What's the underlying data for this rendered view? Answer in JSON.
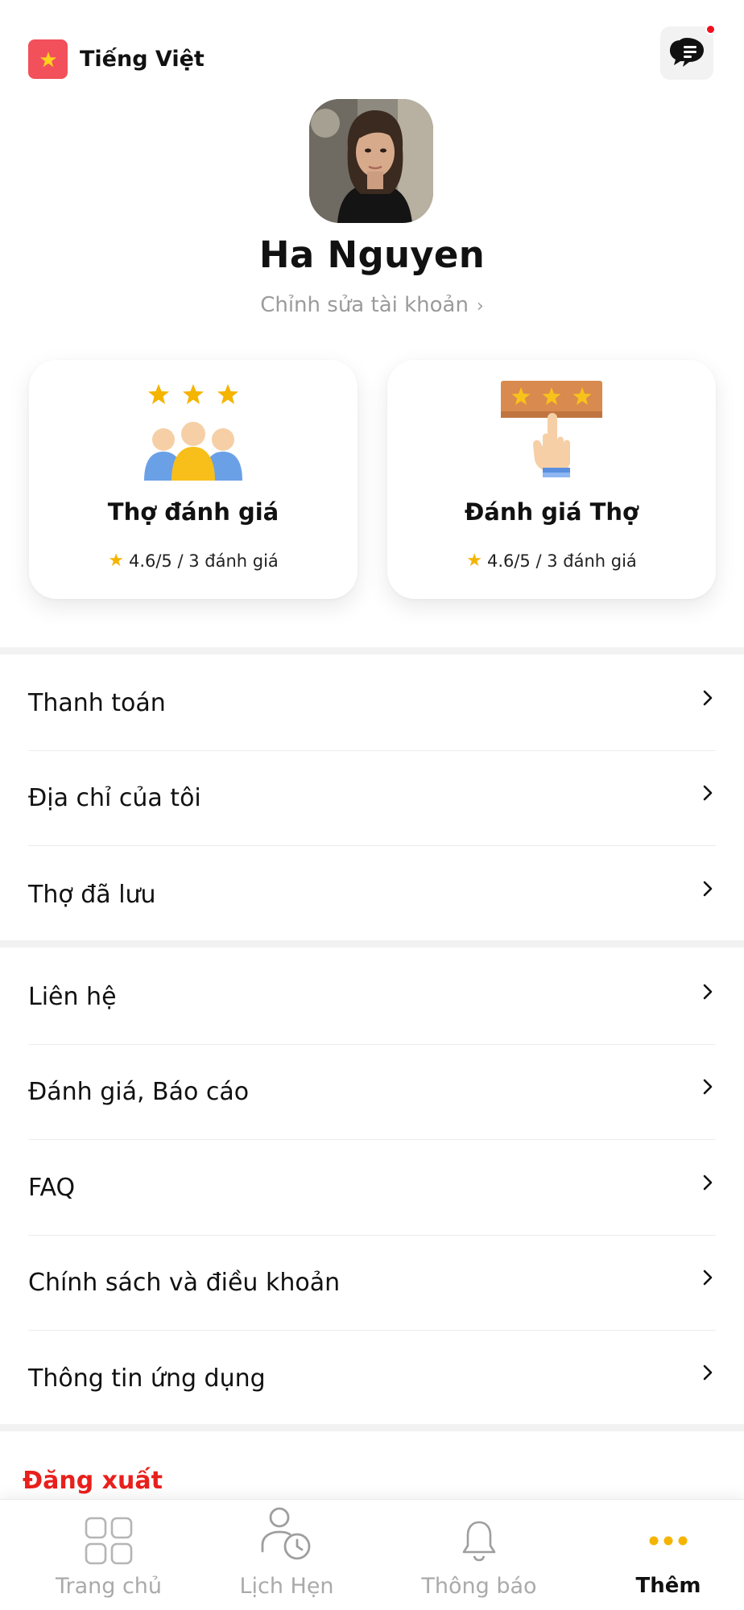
{
  "header": {
    "language_label": "Tiếng Việt",
    "flag_icon": "vietnam-flag-icon",
    "chat_icon": "chat-bubbles-icon",
    "has_unread": true
  },
  "profile": {
    "name": "Ha Nguyen",
    "edit_label": "Chỉnh sửa tài khoản"
  },
  "cards": [
    {
      "title": "Thợ đánh giá",
      "rating": "4.6/5 / 3 đánh giá",
      "icon": "people-rating-icon"
    },
    {
      "title": "Đánh giá Thợ",
      "rating": "4.6/5 / 3 đánh giá",
      "icon": "hand-rating-icon"
    }
  ],
  "menu_group_1": [
    {
      "label": "Thanh toán"
    },
    {
      "label": "Địa chỉ của tôi"
    },
    {
      "label": "Thợ đã lưu"
    }
  ],
  "menu_group_2": [
    {
      "label": "Liên hệ"
    },
    {
      "label": "Đánh giá, Báo cáo"
    },
    {
      "label": "FAQ"
    },
    {
      "label": "Chính sách và điều khoản"
    },
    {
      "label": "Thông tin ứng dụng"
    }
  ],
  "logout_label": "Đăng xuất",
  "bottom_nav": [
    {
      "label": "Trang chủ",
      "icon": "grid-icon",
      "active": false
    },
    {
      "label": "Lịch Hẹn",
      "icon": "user-clock-icon",
      "active": false
    },
    {
      "label": "Thông báo",
      "icon": "bell-icon",
      "active": false
    },
    {
      "label": "Thêm",
      "icon": "more-dots-icon",
      "active": true
    }
  ],
  "colors": {
    "accent": "#f5b400",
    "logout": "#e8201c",
    "flag": "#f2505a",
    "badge": "#f20f1c"
  }
}
